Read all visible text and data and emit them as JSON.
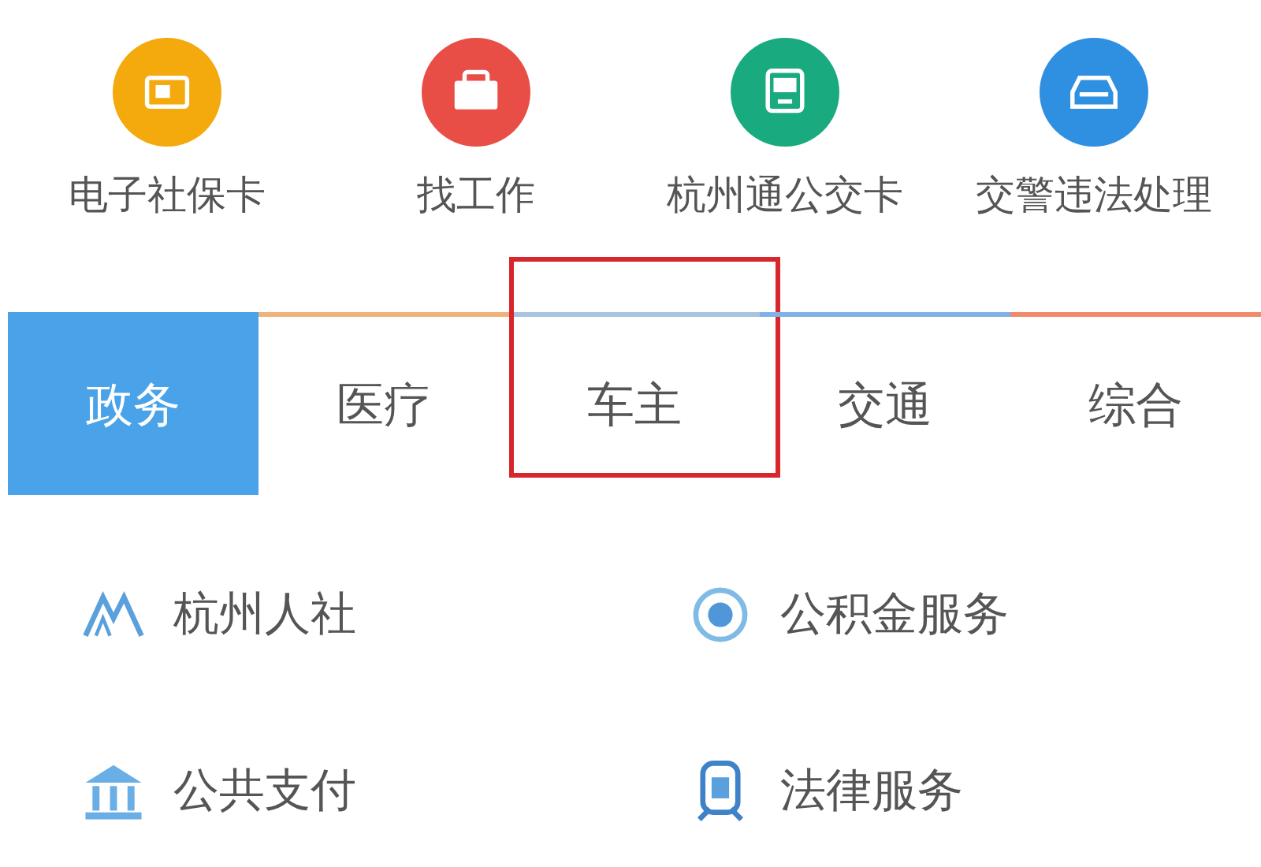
{
  "shortcuts": [
    {
      "label": "电子社保卡",
      "kind": "card",
      "color": "#f4a90c"
    },
    {
      "label": "找工作",
      "kind": "bag",
      "color": "#e94e46"
    },
    {
      "label": "杭州通公交卡",
      "kind": "bus",
      "color": "#1aaa7f"
    },
    {
      "label": "交警违法处理",
      "kind": "car",
      "color": "#2f8fe0"
    }
  ],
  "tabs": [
    {
      "label": "政务",
      "selected": true,
      "color": "#4aa3e8",
      "highlighted": false
    },
    {
      "label": "医疗",
      "selected": false,
      "color": "#f0b27a",
      "highlighted": false
    },
    {
      "label": "车主",
      "selected": false,
      "color": "#a7c4e0",
      "highlighted": true
    },
    {
      "label": "交通",
      "selected": false,
      "color": "#7fb3e8",
      "highlighted": false
    },
    {
      "label": "综合",
      "selected": false,
      "color": "#f08a6a",
      "highlighted": false
    }
  ],
  "services": [
    {
      "label": "杭州人社",
      "kind": "mountain"
    },
    {
      "label": "公积金服务",
      "kind": "coin"
    },
    {
      "label": "公共支付",
      "kind": "bank"
    },
    {
      "label": "法律服务",
      "kind": "badge"
    }
  ]
}
